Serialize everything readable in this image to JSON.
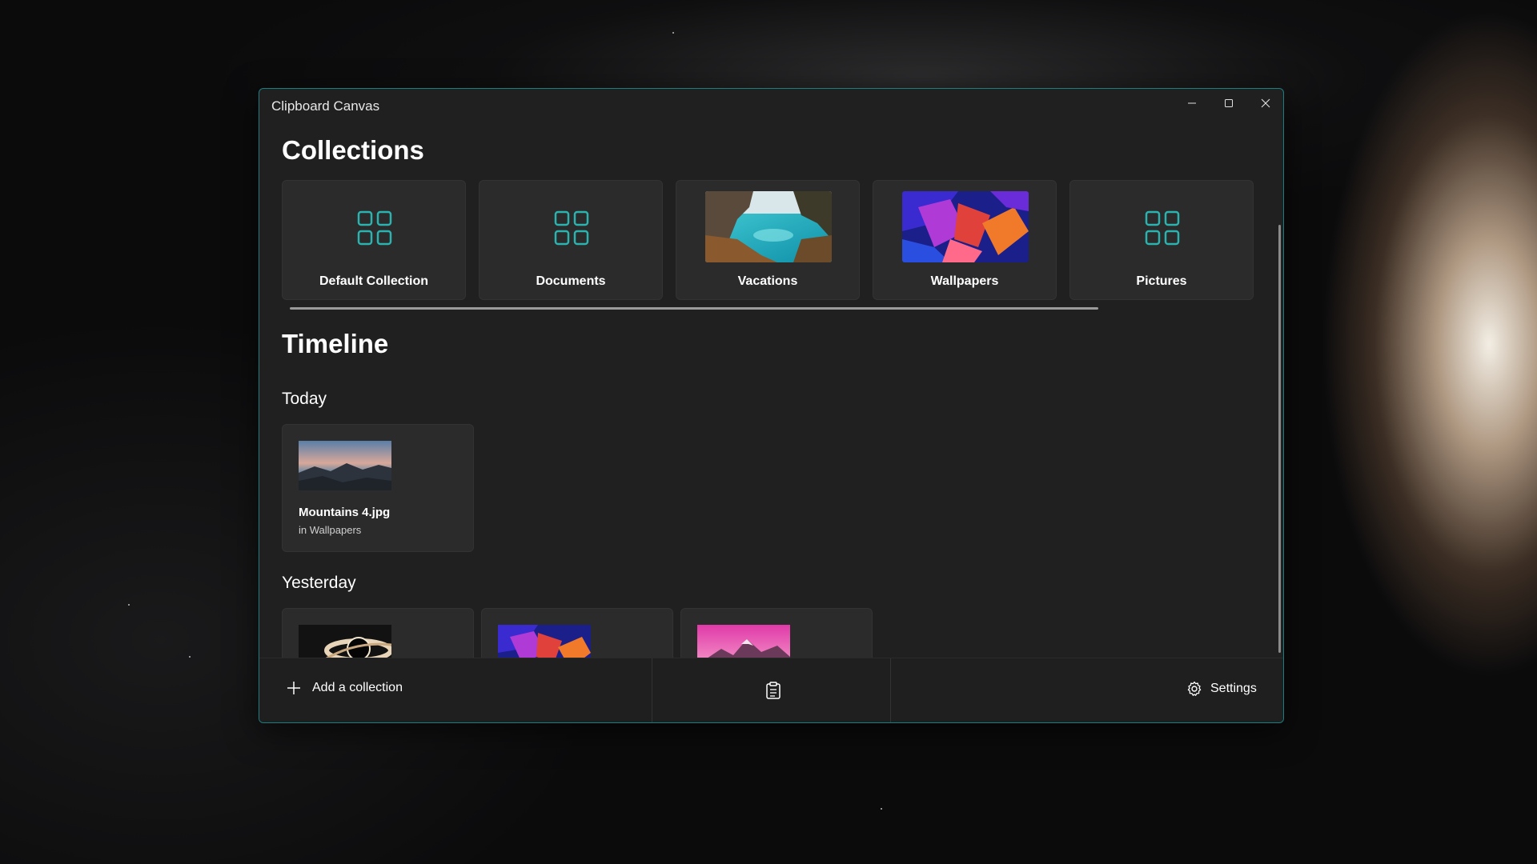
{
  "window": {
    "title": "Clipboard Canvas",
    "accent_color": "#1d7e80"
  },
  "collections": {
    "title": "Collections",
    "items": [
      {
        "label": "Default Collection",
        "icon": "grid-icon"
      },
      {
        "label": "Documents",
        "icon": "grid-icon"
      },
      {
        "label": "Vacations",
        "icon": "image-thumbnail"
      },
      {
        "label": "Wallpapers",
        "icon": "image-thumbnail"
      },
      {
        "label": "Pictures",
        "icon": "grid-icon"
      }
    ]
  },
  "timeline": {
    "title": "Timeline",
    "today": {
      "label": "Today",
      "items": [
        {
          "name": "Mountains 4.jpg",
          "location": "in Wallpapers"
        }
      ]
    },
    "yesterday": {
      "label": "Yesterday"
    }
  },
  "bottom_bar": {
    "add_collection_label": "Add a collection",
    "settings_label": "Settings"
  }
}
